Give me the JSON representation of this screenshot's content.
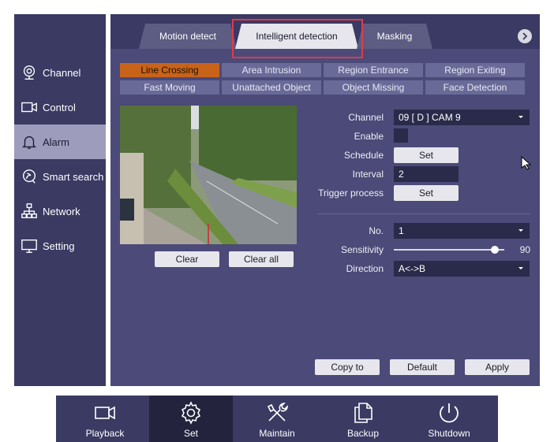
{
  "sidebar": {
    "items": [
      {
        "label": "Channel",
        "icon": "camera-icon"
      },
      {
        "label": "Control",
        "icon": "video-icon"
      },
      {
        "label": "Alarm",
        "icon": "bell-icon",
        "active": true
      },
      {
        "label": "Smart search",
        "icon": "smart-search-icon"
      },
      {
        "label": "Network",
        "icon": "network-icon"
      },
      {
        "label": "Setting",
        "icon": "monitor-icon"
      }
    ]
  },
  "tabs": {
    "motion_detect": "Motion detect",
    "intelligent_detection": "Intelligent detection",
    "masking": "Masking",
    "active": "intelligent_detection"
  },
  "subtabs": [
    "Line Crossing",
    "Area Intrusion",
    "Region Entrance",
    "Region Exiting",
    "Fast Moving",
    "Unattached Object",
    "Object Missing",
    "Face Detection"
  ],
  "preview_buttons": {
    "clear": "Clear",
    "clear_all": "Clear all"
  },
  "form": {
    "channel_label": "Channel",
    "channel_value": "09 [ D ] CAM 9",
    "enable_label": "Enable",
    "enable_checked": false,
    "schedule_label": "Schedule",
    "schedule_button": "Set",
    "interval_label": "Interval",
    "interval_value": "2",
    "trigger_label": "Trigger process",
    "trigger_button": "Set",
    "no_label": "No.",
    "no_value": "1",
    "sensitivity_label": "Sensitivity",
    "sensitivity_value": "90",
    "direction_label": "Direction",
    "direction_value": "A<->B"
  },
  "actions": {
    "copy_to": "Copy to",
    "default": "Default",
    "apply": "Apply"
  },
  "dock": {
    "items": [
      {
        "label": "Playback",
        "icon": "playback-icon"
      },
      {
        "label": "Set",
        "icon": "gear-icon",
        "active": true
      },
      {
        "label": "Maintain",
        "icon": "tools-icon"
      },
      {
        "label": "Backup",
        "icon": "copy-icon"
      },
      {
        "label": "Shutdown",
        "icon": "power-icon"
      }
    ]
  },
  "colors": {
    "panel": "#4b4a78",
    "sidebar": "#3a3a63",
    "active_subtab": "#c8631a",
    "highlight": "#e03a48"
  }
}
